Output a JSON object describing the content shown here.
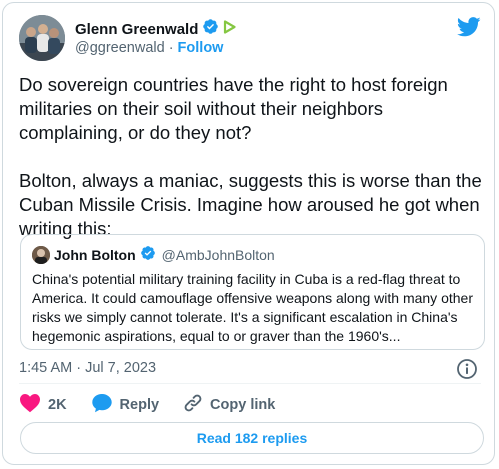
{
  "author": {
    "name": "Glenn Greenwald",
    "handle": "@ggreenwald",
    "separator": "·",
    "follow_label": "Follow"
  },
  "tweet": {
    "text": "Do sovereign countries have the right to host foreign militaries on their soil without their neighbors complaining, or do they not?\n\nBolton, always a maniac, suggests this is worse than the Cuban Missile Crisis. Imagine how aroused he got when writing this:",
    "timestamp": "1:45 AM · Jul 7, 2023"
  },
  "quote": {
    "name": "John Bolton",
    "handle": "@AmbJohnBolton",
    "text": "China's potential military training facility in Cuba is a red-flag threat to America. It could camouflage offensive weapons along with many other risks we simply cannot tolerate. It's a significant escalation in China's hegemonic aspirations, equal to or graver than the 1960's..."
  },
  "actions": {
    "like_count": "2K",
    "reply_label": "Reply",
    "copy_link_label": "Copy link"
  },
  "read_replies_label": "Read 182 replies",
  "icons": {
    "bird": "twitter-bird-icon",
    "verified": "verified-badge-icon",
    "subscribe": "rumble-badge-icon",
    "info": "info-icon",
    "like": "heart-icon",
    "reply": "speech-bubble-icon",
    "link": "link-icon"
  },
  "colors": {
    "accent": "#1d9bf0",
    "like": "#f91880",
    "text": "#0f1419",
    "secondary": "#536471",
    "border": "#cfd9de",
    "badge_green": "#85c742"
  }
}
